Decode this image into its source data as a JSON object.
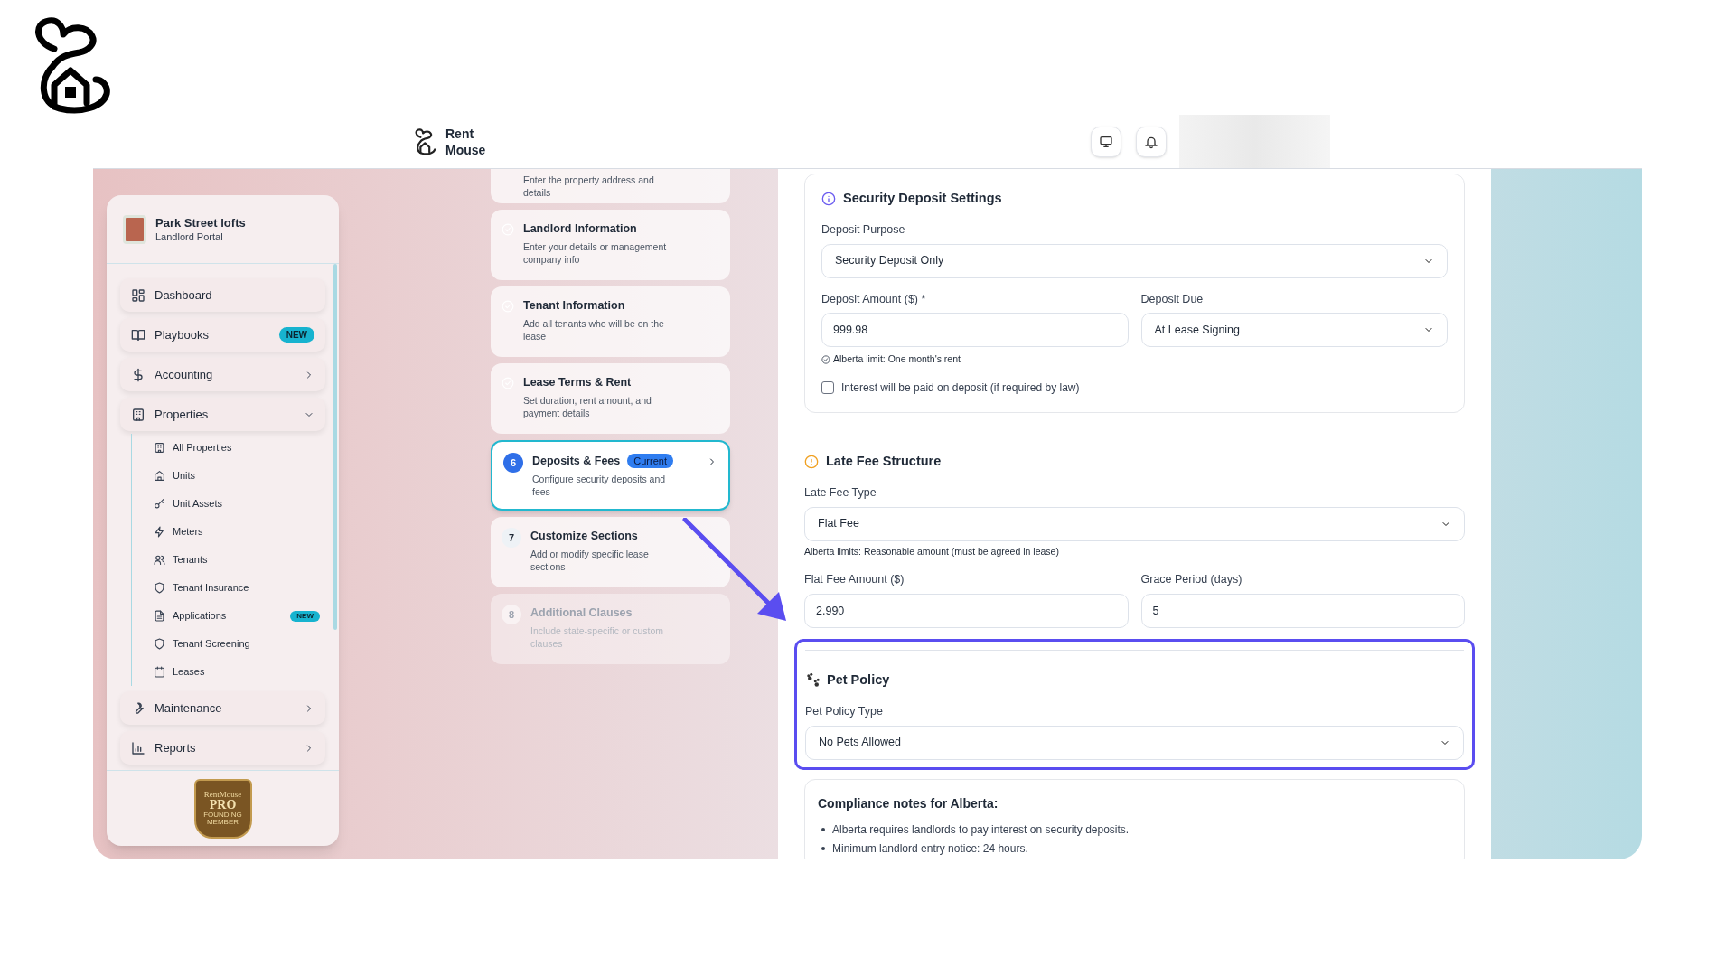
{
  "header": {
    "app_name": "Rent Mouse"
  },
  "sidebar": {
    "property_name": "Park Street lofts",
    "portal": "Landlord Portal",
    "items": [
      {
        "label": "Dashboard"
      },
      {
        "label": "Playbooks",
        "badge": "NEW"
      },
      {
        "label": "Accounting",
        "expanded": false
      },
      {
        "label": "Properties",
        "expanded": true,
        "children": [
          {
            "label": "All Properties"
          },
          {
            "label": "Units"
          },
          {
            "label": "Unit Assets"
          },
          {
            "label": "Meters"
          },
          {
            "label": "Tenants"
          },
          {
            "label": "Tenant Insurance"
          },
          {
            "label": "Applications",
            "badge": "NEW"
          },
          {
            "label": "Tenant Screening"
          },
          {
            "label": "Leases"
          }
        ]
      },
      {
        "label": "Maintenance",
        "expanded": false
      },
      {
        "label": "Reports",
        "expanded": false
      }
    ],
    "badge_lines": [
      "RentMouse",
      "PRO",
      "FOUNDING",
      "MEMBER"
    ]
  },
  "steps": [
    {
      "kind": "done",
      "description": "Enter the property address and details"
    },
    {
      "kind": "done",
      "title": "Landlord Information",
      "description": "Enter your details or management company info"
    },
    {
      "kind": "done",
      "title": "Tenant Information",
      "description": "Add all tenants who will be on the lease"
    },
    {
      "kind": "done",
      "title": "Lease Terms & Rent",
      "description": "Set duration, rent amount, and payment details"
    },
    {
      "kind": "current",
      "number": "6",
      "title": "Deposits & Fees",
      "tag": "Current",
      "description": "Configure security deposits and fees"
    },
    {
      "kind": "upcoming",
      "number": "7",
      "title": "Customize Sections",
      "description": "Add or modify specific lease sections"
    },
    {
      "kind": "disabled",
      "number": "8",
      "title": "Additional Clauses",
      "description": "Include state-specific or custom clauses"
    }
  ],
  "security_deposit": {
    "title": "Security Deposit Settings",
    "purpose": {
      "label": "Deposit Purpose",
      "value": "Security Deposit Only"
    },
    "amount": {
      "label": "Deposit Amount ($) *",
      "value": "999.98"
    },
    "due": {
      "label": "Deposit Due",
      "value": "At Lease Signing"
    },
    "limit_note": "Alberta limit: One month's rent",
    "interest": {
      "label": "Interest will be paid on deposit (if required by law)",
      "checked": false
    }
  },
  "late_fee": {
    "title": "Late Fee Structure",
    "type": {
      "label": "Late Fee Type",
      "value": "Flat Fee"
    },
    "note": "Alberta limits: Reasonable amount (must be agreed in lease)",
    "flat_amount": {
      "label": "Flat Fee Amount ($)",
      "value": "2.990"
    },
    "grace": {
      "label": "Grace Period (days)",
      "value": "5"
    }
  },
  "pet_policy": {
    "title": "Pet Policy",
    "highlighted": true,
    "type": {
      "label": "Pet Policy Type",
      "value": "No Pets Allowed"
    }
  },
  "compliance": {
    "title": "Compliance notes for Alberta:",
    "notes": [
      "Alberta requires landlords to pay interest on security deposits.",
      "Minimum landlord entry notice: 24 hours."
    ]
  }
}
